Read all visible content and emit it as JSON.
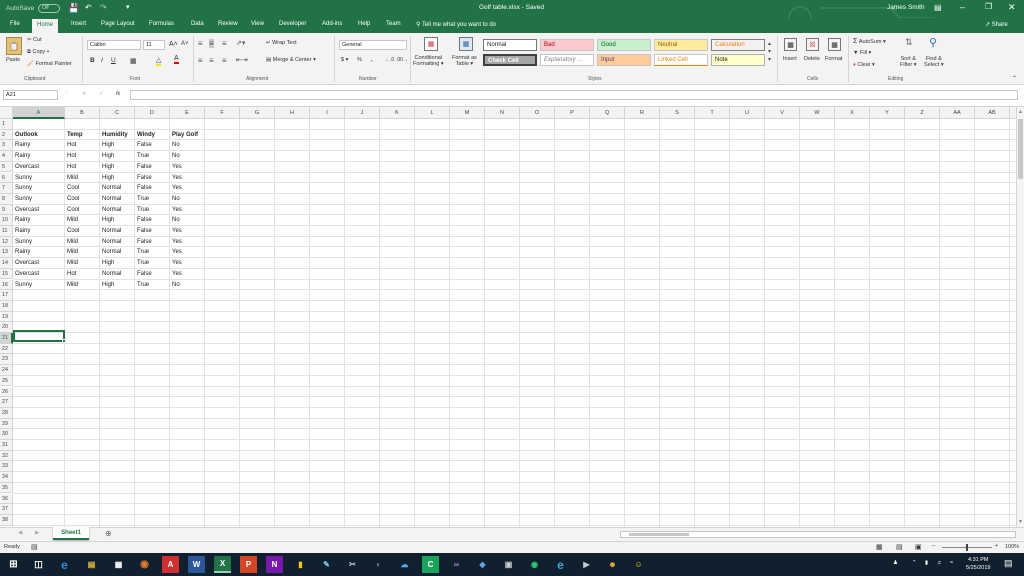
{
  "titlebar": {
    "autosave": "AutoSave",
    "autosave_state": "Off",
    "filename": "Golf table.xlsx",
    "save_state": "Saved",
    "user": "James Smith"
  },
  "tabs": [
    {
      "label": "File"
    },
    {
      "label": "Home"
    },
    {
      "label": "Insert"
    },
    {
      "label": "Page Layout"
    },
    {
      "label": "Formulas"
    },
    {
      "label": "Data"
    },
    {
      "label": "Review"
    },
    {
      "label": "View"
    },
    {
      "label": "Developer"
    },
    {
      "label": "Add-ins"
    },
    {
      "label": "Help"
    },
    {
      "label": "Team"
    }
  ],
  "tellme": "Tell me what you want to do",
  "share": "Share",
  "ribbon": {
    "paste": "Paste",
    "cut": "Cut",
    "copy": "Copy",
    "format_painter": "Format Painter",
    "font_name": "Calibri",
    "font_size": "11",
    "bold": "B",
    "italic": "I",
    "underline": "U",
    "wrap_text": "Wrap Text",
    "merge_center": "Merge & Center",
    "number_format": "General",
    "conditional_formatting": "Conditional",
    "conditional_formatting2": "Formatting",
    "format_as_table": "Format as",
    "format_as_table2": "Table",
    "styles": {
      "normal": "Normal",
      "bad": "Bad",
      "good": "Good",
      "neutral": "Neutral",
      "calculation": "Calculation",
      "check_cell": "Check Cell",
      "explanatory": "Explanatory ...",
      "input": "Input",
      "linked_cell": "Linked Cell",
      "note": "Note"
    },
    "insert": "Insert",
    "delete": "Delete",
    "format": "Format",
    "autosum": "AutoSum",
    "fill": "Fill",
    "clear": "Clear",
    "sort_filter": "Sort &",
    "sort_filter2": "Filter",
    "find_select": "Find &",
    "find_select2": "Select",
    "groups": {
      "clipboard": "Clipboard",
      "font": "Font",
      "alignment": "Alignment",
      "number": "Number",
      "styles": "Styles",
      "cells": "Cells",
      "editing": "Editing"
    }
  },
  "formula_bar": {
    "name_box": "A21",
    "fx": "fx",
    "content": ""
  },
  "columns": [
    "A",
    "B",
    "C",
    "D",
    "E",
    "F",
    "G",
    "H",
    "I",
    "J",
    "K",
    "L",
    "M",
    "N",
    "O",
    "P",
    "Q",
    "R",
    "S",
    "T",
    "U",
    "V",
    "W",
    "X",
    "Y",
    "Z",
    "AA",
    "AB",
    "AC"
  ],
  "rows": [
    "1",
    "2",
    "3",
    "4",
    "5",
    "6",
    "7",
    "8",
    "9",
    "10",
    "11",
    "12",
    "13",
    "14",
    "15",
    "16",
    "17",
    "18",
    "19",
    "20",
    "21",
    "22",
    "23",
    "24",
    "25",
    "26",
    "27",
    "28",
    "29",
    "30",
    "31",
    "32",
    "33",
    "34",
    "35",
    "36",
    "37",
    "38"
  ],
  "table": {
    "header": [
      "Outlook",
      "Temp",
      "Humidity",
      "Windy",
      "Play Golf"
    ],
    "rows": [
      [
        "Rainy",
        "Hot",
        "High",
        "False",
        "No"
      ],
      [
        "Rainy",
        "Hot",
        "High",
        "True",
        "No"
      ],
      [
        "Overcast",
        "Hot",
        "High",
        "False",
        "Yes"
      ],
      [
        "Sunny",
        "Mild",
        "High",
        "False",
        "Yes"
      ],
      [
        "Sunny",
        "Cool",
        "Normal",
        "False",
        "Yes"
      ],
      [
        "Sunny",
        "Cool",
        "Normal",
        "True",
        "No"
      ],
      [
        "Overcast",
        "Cool",
        "Normal",
        "True",
        "Yes"
      ],
      [
        "Rainy",
        "Mild",
        "High",
        "False",
        "No"
      ],
      [
        "Rainy",
        "Cool",
        "Normal",
        "False",
        "Yes"
      ],
      [
        "Sunny",
        "Mild",
        "Normal",
        "False",
        "Yes"
      ],
      [
        "Rainy",
        "Mild",
        "Normal",
        "True",
        "Yes"
      ],
      [
        "Overcast",
        "Mild",
        "High",
        "True",
        "Yes"
      ],
      [
        "Overcast",
        "Hot",
        "Normal",
        "False",
        "Yes"
      ],
      [
        "Sunny",
        "Mild",
        "High",
        "True",
        "No"
      ]
    ]
  },
  "sheet_tab": "Sheet1",
  "status": {
    "ready": "Ready",
    "zoom": "100%"
  },
  "taskbar": {
    "time": "4:31 PM",
    "date": "5/25/2019"
  },
  "colors": {
    "excel_green": "#217346",
    "taskbar": "#10202e",
    "selection": "#217346"
  }
}
